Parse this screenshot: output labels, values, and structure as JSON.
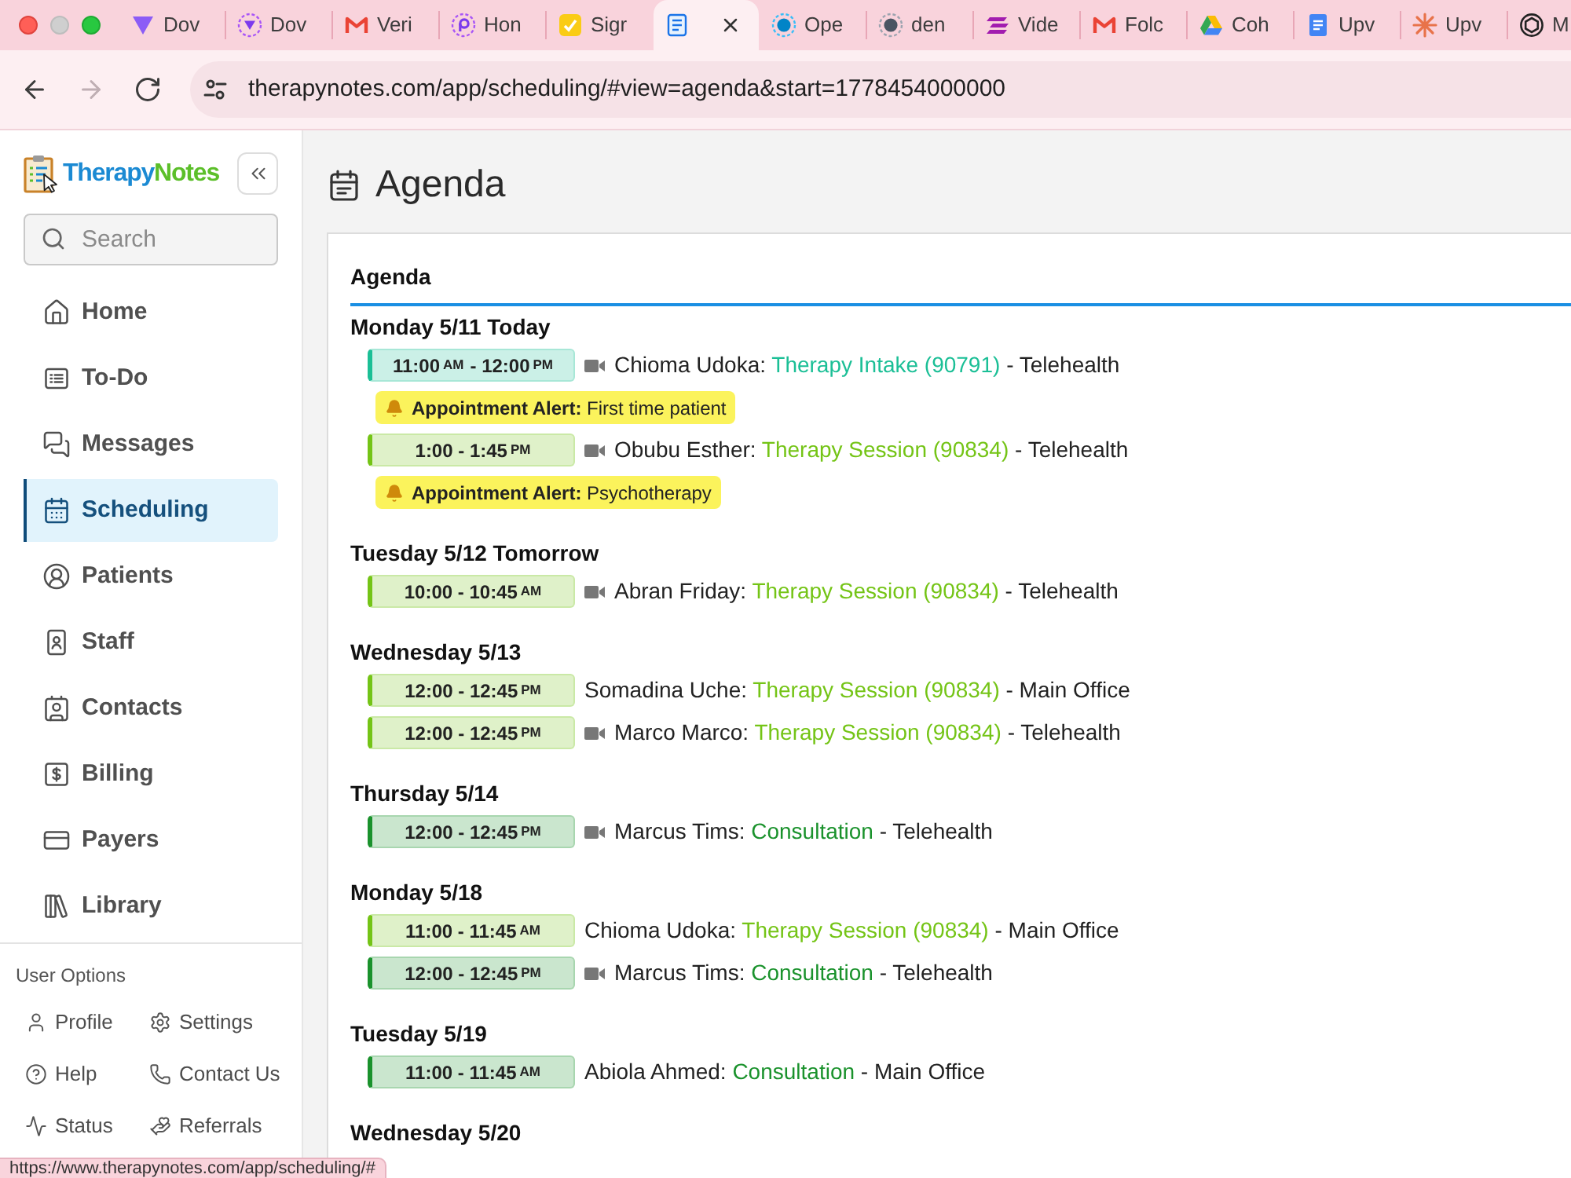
{
  "browser": {
    "tabs": [
      {
        "title": "Dov",
        "selected": false
      },
      {
        "title": "Dov",
        "selected": false
      },
      {
        "title": "Veri",
        "selected": false
      },
      {
        "title": "Hon",
        "selected": false
      },
      {
        "title": "Sigr",
        "selected": false
      },
      {
        "selected": true
      },
      {
        "title": "Ope",
        "selected": false
      },
      {
        "title": "den",
        "selected": false
      },
      {
        "title": "Vide",
        "selected": false
      },
      {
        "title": "Folc",
        "selected": false
      },
      {
        "title": "Coh",
        "selected": false
      },
      {
        "title": "Upv",
        "selected": false
      },
      {
        "title": "Upv",
        "selected": false
      },
      {
        "title": "M",
        "selected": false
      }
    ],
    "nav_buttons": [
      {
        "kind": "back",
        "disabled": false
      },
      {
        "kind": "forward",
        "disabled": true
      },
      {
        "kind": "reload",
        "disabled": false
      }
    ],
    "url": "therapynotes.com/app/scheduling/#view=agenda&start=1778454000000",
    "status_url": "https://www.therapynotes.com/app/scheduling/#"
  },
  "sidebar": {
    "logo": [
      {
        "text": "Therapy",
        "color": "#1b8ad3"
      },
      {
        "text": "Notes",
        "color": "#5cbf2a"
      }
    ],
    "search": {
      "placeholder": "Search"
    },
    "nav": [
      {
        "label": "Home",
        "selected": false
      },
      {
        "label": "To-Do",
        "selected": false
      },
      {
        "label": "Messages",
        "selected": false
      },
      {
        "label": "Scheduling",
        "selected": true
      },
      {
        "label": "Patients",
        "selected": false
      },
      {
        "label": "Staff",
        "selected": false
      },
      {
        "label": "Contacts",
        "selected": false
      },
      {
        "label": "Billing",
        "selected": false
      },
      {
        "label": "Payers",
        "selected": false
      },
      {
        "label": "Library",
        "selected": false
      }
    ],
    "user_options": {
      "title": "User Options",
      "items": [
        {
          "label": "Profile"
        },
        {
          "label": "Settings"
        },
        {
          "label": "Help"
        },
        {
          "label": "Contact Us"
        },
        {
          "label": "Status"
        },
        {
          "label": "Referrals"
        }
      ]
    }
  },
  "main": {
    "title": "Agenda",
    "card_title": "Agenda",
    "days": [
      {
        "heading": "Monday 5/11 Today",
        "items": [
          {
            "kind": "appointment",
            "color": "#1bbf96",
            "time": [
              {
                "text": "11:00",
                "kind": "clock"
              },
              {
                "text": "AM",
                "kind": "meridiem"
              },
              {
                "text": "- 12:00",
                "kind": "clock"
              },
              {
                "text": "PM",
                "kind": "meridiem"
              }
            ],
            "video": true,
            "client": "Chioma Udoka:",
            "service": "Therapy Intake (90791)",
            "location": "- Telehealth"
          },
          {
            "kind": "alert",
            "text": "**Appointment Alert:** First time patient"
          },
          {
            "kind": "appointment",
            "color": "#74c416",
            "time": [
              {
                "text": "1:00 - 1:45",
                "kind": "clock"
              },
              {
                "text": "PM",
                "kind": "meridiem"
              }
            ],
            "video": true,
            "client": "Obubu Esther:",
            "service": "Therapy Session (90834)",
            "location": "- Telehealth"
          },
          {
            "kind": "alert",
            "text": "**Appointment Alert:** Psychotherapy"
          }
        ]
      },
      {
        "heading": "Tuesday 5/12 Tomorrow",
        "items": [
          {
            "kind": "appointment",
            "color": "#74c416",
            "time": [
              {
                "text": "10:00 - 10:45",
                "kind": "clock"
              },
              {
                "text": "AM",
                "kind": "meridiem"
              }
            ],
            "video": true,
            "client": "Abran Friday:",
            "service": "Therapy Session (90834)",
            "location": "- Telehealth"
          }
        ]
      },
      {
        "heading": "Wednesday 5/13",
        "items": [
          {
            "kind": "appointment",
            "color": "#74c416",
            "time": [
              {
                "text": "12:00 - 12:45",
                "kind": "clock"
              },
              {
                "text": "PM",
                "kind": "meridiem"
              }
            ],
            "video": false,
            "client": "Somadina Uche:",
            "service": "Therapy Session (90834)",
            "location": "- Main Office"
          },
          {
            "kind": "appointment",
            "color": "#74c416",
            "time": [
              {
                "text": "12:00 - 12:45",
                "kind": "clock"
              },
              {
                "text": "PM",
                "kind": "meridiem"
              }
            ],
            "video": true,
            "client": "Marco Marco:",
            "service": "Therapy Session (90834)",
            "location": "- Telehealth"
          }
        ]
      },
      {
        "heading": "Thursday 5/14",
        "items": [
          {
            "kind": "appointment",
            "color": "#1a922c",
            "time": [
              {
                "text": "12:00 - 12:45",
                "kind": "clock"
              },
              {
                "text": "PM",
                "kind": "meridiem"
              }
            ],
            "video": true,
            "client": "Marcus Tims:",
            "service": "Consultation",
            "location": "- Telehealth"
          }
        ]
      },
      {
        "heading": "Monday 5/18",
        "items": [
          {
            "kind": "appointment",
            "color": "#74c416",
            "time": [
              {
                "text": "11:00 - 11:45",
                "kind": "clock"
              },
              {
                "text": "AM",
                "kind": "meridiem"
              }
            ],
            "video": false,
            "client": "Chioma Udoka:",
            "service": "Therapy Session (90834)",
            "location": "- Main Office"
          },
          {
            "kind": "appointment",
            "color": "#1a922c",
            "time": [
              {
                "text": "12:00 - 12:45",
                "kind": "clock"
              },
              {
                "text": "PM",
                "kind": "meridiem"
              }
            ],
            "video": true,
            "client": "Marcus Tims:",
            "service": "Consultation",
            "location": "- Telehealth"
          }
        ]
      },
      {
        "heading": "Tuesday 5/19",
        "items": [
          {
            "kind": "appointment",
            "color": "#1a922c",
            "time": [
              {
                "text": "11:00 - 11:45",
                "kind": "clock"
              },
              {
                "text": "AM",
                "kind": "meridiem"
              }
            ],
            "video": false,
            "client": "Abiola Ahmed:",
            "service": "Consultation",
            "location": "- Main Office"
          }
        ]
      },
      {
        "heading": "Wednesday 5/20"
      }
    ]
  }
}
